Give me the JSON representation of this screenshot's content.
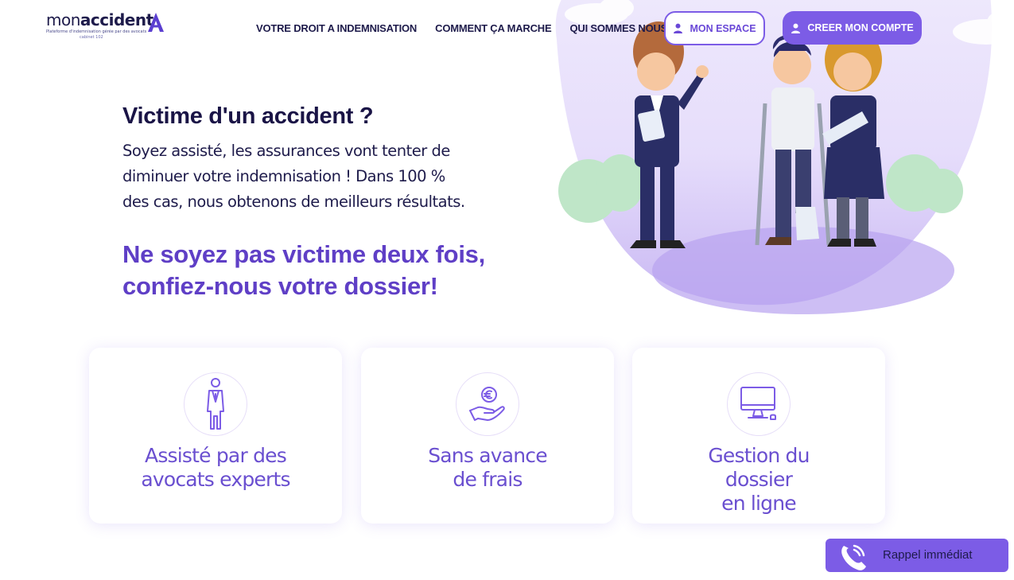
{
  "brand": {
    "name_light": "mon",
    "name_bold": "accident",
    "tagline": "Plateforme d'indemnisation gérée par des avocats",
    "sub": "cabinet 102",
    "accent": "#7c5ce6",
    "dark": "#1e1b4b"
  },
  "nav": {
    "items": [
      {
        "label": "VOTRE DROIT A INDEMNISATION"
      },
      {
        "label": "COMMENT ÇA MARCHE"
      },
      {
        "label": "QUI SOMMES NOUS"
      }
    ],
    "mon_espace": {
      "label": "MON ESPACE",
      "icon": "user-icon"
    },
    "creer_compte": {
      "label": "CREER MON COMPTE",
      "icon": "user-icon"
    }
  },
  "hero": {
    "title": "Victime d'un accident ?",
    "body_lines": [
      "Soyez assisté, les assurances vont tenter de",
      "diminuer votre indemnisation ! Dans 100 %",
      "des cas, nous obtenons de meilleurs résultats."
    ],
    "tagline_lines": [
      "Ne soyez pas victime deux fois,",
      "confiez-nous votre dossier!"
    ]
  },
  "features": [
    {
      "icon": "lawyer-icon",
      "lines": [
        "Assisté par des",
        "avocats experts"
      ]
    },
    {
      "icon": "euro-hand-icon",
      "lines": [
        "Sans avance",
        "de frais"
      ]
    },
    {
      "icon": "computer-icon",
      "lines": [
        "Gestion du",
        "dossier",
        "en ligne"
      ]
    }
  ],
  "rappel": {
    "label": "Rappel immédiat",
    "icon": "phone-icon"
  }
}
